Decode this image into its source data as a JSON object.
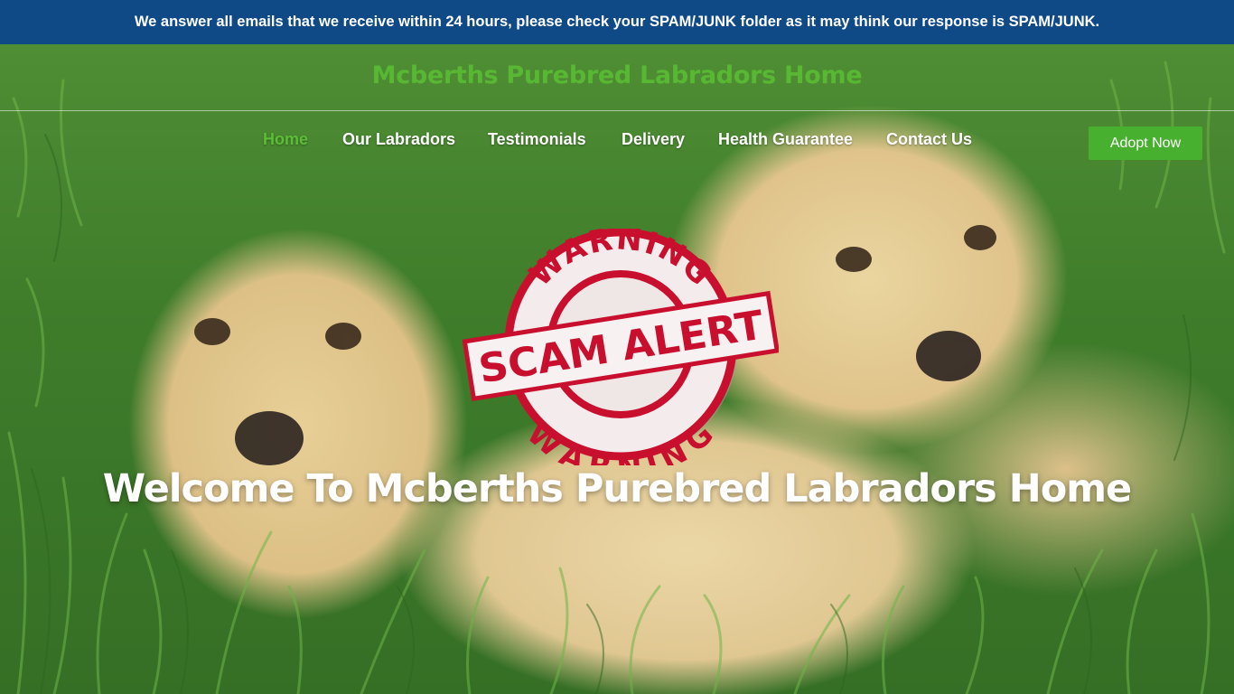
{
  "announcement": {
    "text": "We answer all emails that we receive within 24 hours, please check your SPAM/JUNK folder as it may think our response is SPAM/JUNK."
  },
  "header": {
    "site_title": "Mcberths Purebred Labradors Home"
  },
  "nav": {
    "items": [
      {
        "label": "Home",
        "active": true
      },
      {
        "label": "Our Labradors",
        "active": false
      },
      {
        "label": "Testimonials",
        "active": false
      },
      {
        "label": "Delivery",
        "active": false
      },
      {
        "label": "Health Guarantee",
        "active": false
      },
      {
        "label": "Contact Us",
        "active": false
      }
    ],
    "cta_label": "Adopt Now"
  },
  "hero": {
    "image_icon": "labrador-puppies-image",
    "badge": {
      "top_text": "WARNING",
      "center_text": "SCAM ALERT",
      "bottom_text": "WARNING"
    },
    "heading": "Welcome To Mcberths Purebred Labradors Home"
  },
  "colors": {
    "announcement_bg": "#0f4a87",
    "brand_green": "#58b833",
    "cta_green": "#48b02f",
    "badge_red": "#c8102e"
  }
}
